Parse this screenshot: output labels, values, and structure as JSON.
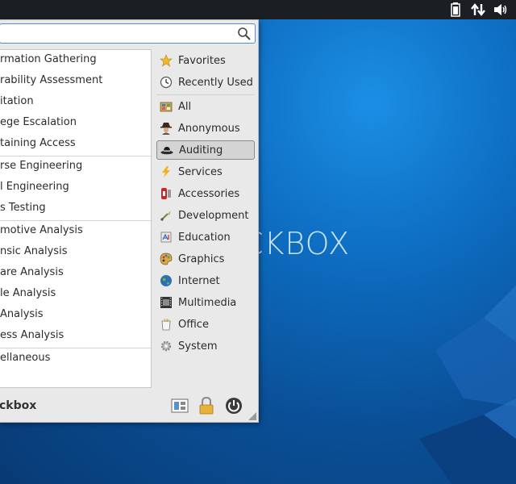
{
  "wallpaper": {
    "logo_text": "CKBOX"
  },
  "tray": {
    "battery": "battery-icon",
    "network": "network-icon",
    "volume": "volume-icon"
  },
  "search": {
    "value": "",
    "placeholder": ""
  },
  "apps": [
    "rmation Gathering",
    "rability Assessment",
    "itation",
    "ege Escalation",
    "taining Access",
    "rse Engineering",
    "l Engineering",
    "s Testing",
    "motive Analysis",
    "nsic Analysis",
    "are Analysis",
    "le Analysis",
    "Analysis",
    "ess Analysis",
    "ellaneous"
  ],
  "categories": [
    {
      "label": "Favorites",
      "icon": "star-icon"
    },
    {
      "label": "Recently Used",
      "icon": "clock-icon"
    },
    {
      "label": "All",
      "icon": "folder-icon"
    },
    {
      "label": "Anonymous",
      "icon": "spy-icon"
    },
    {
      "label": "Auditing",
      "icon": "hat-icon",
      "selected": true
    },
    {
      "label": "Services",
      "icon": "lightning-icon"
    },
    {
      "label": "Accessories",
      "icon": "accessories-icon"
    },
    {
      "label": "Development",
      "icon": "development-icon"
    },
    {
      "label": "Education",
      "icon": "education-icon"
    },
    {
      "label": "Graphics",
      "icon": "graphics-icon"
    },
    {
      "label": "Internet",
      "icon": "globe-icon"
    },
    {
      "label": "Multimedia",
      "icon": "film-icon"
    },
    {
      "label": "Office",
      "icon": "office-icon"
    },
    {
      "label": "System",
      "icon": "gear-icon"
    }
  ],
  "footer": {
    "user_label": "ckbox"
  },
  "colors": {
    "accent": "#4f8fd0",
    "selected_bg": "#d4d4d4",
    "menu_bg": "#e9e9e9"
  }
}
